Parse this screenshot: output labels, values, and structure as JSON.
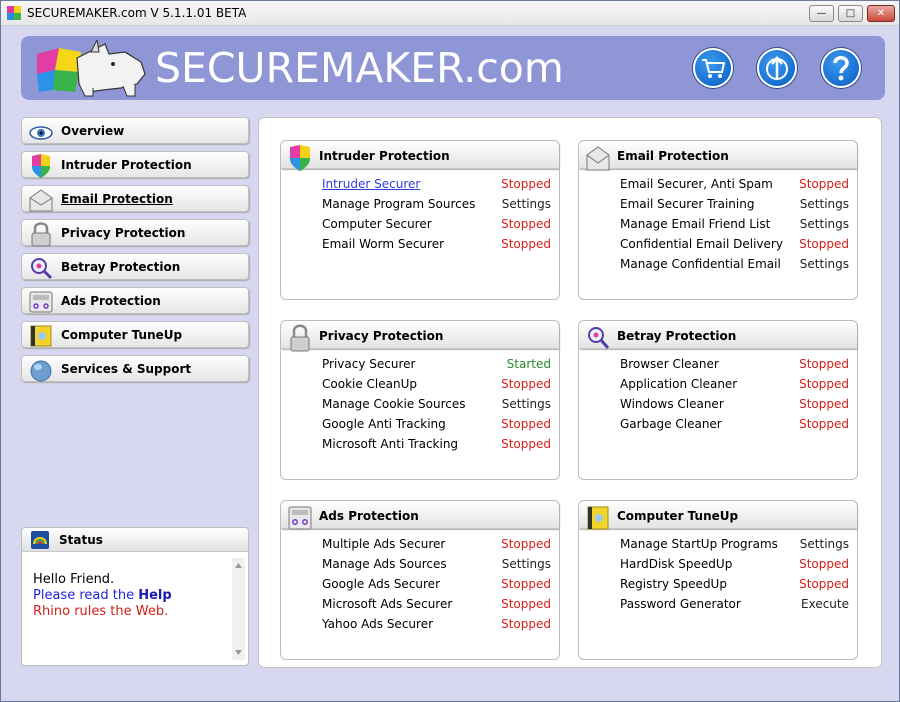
{
  "window": {
    "title": "SECUREMAKER.com V 5.1.1.01 BETA",
    "minimize_label": "—",
    "maximize_label": "□",
    "close_label": "✕"
  },
  "banner": {
    "brand": "SECUREMAKER.com",
    "buttons": [
      {
        "name": "shop-button",
        "icon": "cart-icon"
      },
      {
        "name": "update-button",
        "icon": "globe-arrow-icon"
      },
      {
        "name": "help-button",
        "icon": "question-icon"
      }
    ]
  },
  "sidebar": {
    "items": [
      {
        "label": "Overview",
        "icon": "eye-icon"
      },
      {
        "label": "Intruder Protection",
        "icon": "shield-icon"
      },
      {
        "label": "Email Protection",
        "icon": "envelope-icon"
      },
      {
        "label": "Privacy Protection",
        "icon": "lock-icon"
      },
      {
        "label": "Betray Protection",
        "icon": "magnifier-icon"
      },
      {
        "label": "Ads Protection",
        "icon": "ads-icon"
      },
      {
        "label": "Computer TuneUp",
        "icon": "folder-gear-icon"
      },
      {
        "label": "Services & Support",
        "icon": "globe-icon"
      }
    ],
    "active_index": 2
  },
  "status": {
    "title": "Status",
    "line1": "Hello Friend.",
    "line2_prefix": "Please read the ",
    "line2_link": "Help",
    "line3": "Rhino rules the Web."
  },
  "colors": {
    "stopped": "#d2201a",
    "started": "#2c8a2c",
    "link": "#2f3cd8",
    "banner": "#8f96d5",
    "window_bg": "#d7d8ef"
  },
  "cards": [
    {
      "title": "Intruder Protection",
      "icon": "shield-icon",
      "rows": [
        {
          "name": "Intruder Securer",
          "status": "Stopped",
          "kind": "stopped",
          "link": true
        },
        {
          "name": "Manage Program Sources",
          "status": "Settings",
          "kind": "settings"
        },
        {
          "name": "Computer Securer",
          "status": "Stopped",
          "kind": "stopped"
        },
        {
          "name": "Email Worm Securer",
          "status": "Stopped",
          "kind": "stopped"
        }
      ]
    },
    {
      "title": "Email Protection",
      "icon": "envelope-icon",
      "rows": [
        {
          "name": "Email Securer, Anti Spam",
          "status": "Stopped",
          "kind": "stopped"
        },
        {
          "name": "Email Securer Training",
          "status": "Settings",
          "kind": "settings"
        },
        {
          "name": "Manage Email Friend List",
          "status": "Settings",
          "kind": "settings"
        },
        {
          "name": "Confidential Email Delivery",
          "status": "Stopped",
          "kind": "stopped"
        },
        {
          "name": "Manage Confidential Email",
          "status": "Settings",
          "kind": "settings"
        }
      ]
    },
    {
      "title": "Privacy Protection",
      "icon": "lock-icon",
      "rows": [
        {
          "name": "Privacy Securer",
          "status": "Started",
          "kind": "started"
        },
        {
          "name": "Cookie CleanUp",
          "status": "Stopped",
          "kind": "stopped"
        },
        {
          "name": "Manage Cookie Sources",
          "status": "Settings",
          "kind": "settings"
        },
        {
          "name": "Google Anti Tracking",
          "status": "Stopped",
          "kind": "stopped"
        },
        {
          "name": "Microsoft Anti Tracking",
          "status": "Stopped",
          "kind": "stopped"
        }
      ]
    },
    {
      "title": "Betray Protection",
      "icon": "magnifier-icon",
      "rows": [
        {
          "name": "Browser Cleaner",
          "status": "Stopped",
          "kind": "stopped"
        },
        {
          "name": "Application Cleaner",
          "status": "Stopped",
          "kind": "stopped"
        },
        {
          "name": "Windows Cleaner",
          "status": "Stopped",
          "kind": "stopped"
        },
        {
          "name": "Garbage Cleaner",
          "status": "Stopped",
          "kind": "stopped"
        }
      ]
    },
    {
      "title": "Ads Protection",
      "icon": "ads-icon",
      "rows": [
        {
          "name": "Multiple Ads Securer",
          "status": "Stopped",
          "kind": "stopped"
        },
        {
          "name": "Manage Ads Sources",
          "status": "Settings",
          "kind": "settings"
        },
        {
          "name": "Google Ads Securer",
          "status": "Stopped",
          "kind": "stopped"
        },
        {
          "name": "Microsoft Ads Securer",
          "status": "Stopped",
          "kind": "stopped"
        },
        {
          "name": "Yahoo Ads Securer",
          "status": "Stopped",
          "kind": "stopped"
        }
      ]
    },
    {
      "title": "Computer TuneUp",
      "icon": "folder-gear-icon",
      "rows": [
        {
          "name": "Manage StartUp Programs",
          "status": "Settings",
          "kind": "settings"
        },
        {
          "name": "HardDisk SpeedUp",
          "status": "Stopped",
          "kind": "stopped"
        },
        {
          "name": "Registry SpeedUp",
          "status": "Stopped",
          "kind": "stopped"
        },
        {
          "name": "Password Generator",
          "status": "Execute",
          "kind": "settings"
        }
      ]
    }
  ]
}
